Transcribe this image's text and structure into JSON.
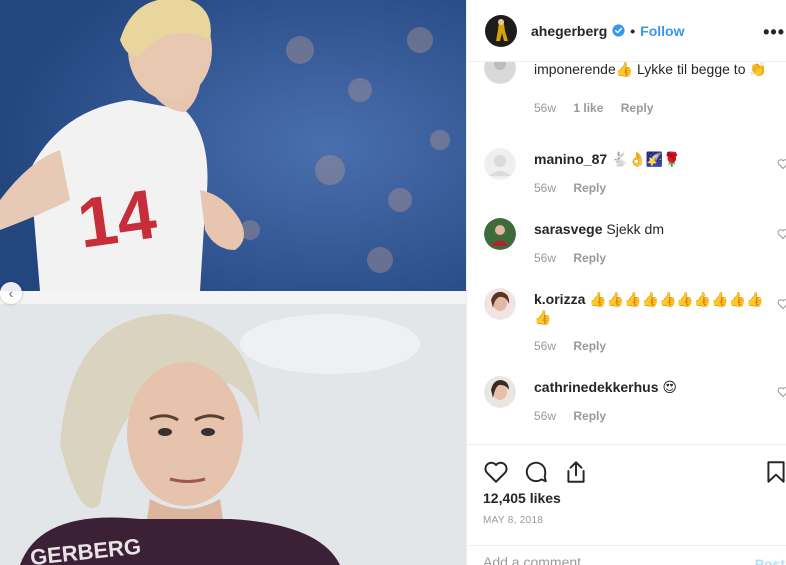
{
  "post": {
    "username": "ahegerberg",
    "follow_label": "Follow",
    "more_label": "•••",
    "dot": "•"
  },
  "carousel": {
    "prev_icon": "‹"
  },
  "comments": [
    {
      "username": "",
      "text": "imponerende👍 Lykke til begge to 👏",
      "age": "56w",
      "likes": "1 like",
      "reply": "Reply"
    },
    {
      "username": "manino_87",
      "text": "🐇👌🌠🌹",
      "age": "56w",
      "likes": "",
      "reply": "Reply"
    },
    {
      "username": "sarasvege",
      "text": "Sjekk dm",
      "age": "56w",
      "likes": "",
      "reply": "Reply"
    },
    {
      "username": "k.orizza",
      "text": "👍👍👍👍👍👍👍👍👍👍👍",
      "age": "56w",
      "likes": "",
      "reply": "Reply"
    },
    {
      "username": "cathrinedekkerhus",
      "text": "😍",
      "age": "56w",
      "likes": "",
      "reply": "Reply"
    }
  ],
  "actions": {
    "likes_count": "12,405 likes",
    "date": "MAY 8, 2018",
    "comment_placeholder": "Add a comment...",
    "post_label": "Post"
  },
  "icons": {
    "verified": "verified-badge-icon",
    "heart": "heart-icon",
    "comment": "comment-icon",
    "share": "share-icon",
    "bookmark": "bookmark-icon"
  },
  "colors": {
    "follow": "#3897f0",
    "meta": "#999999",
    "text": "#262626",
    "post_disabled": "#b2dffc"
  }
}
